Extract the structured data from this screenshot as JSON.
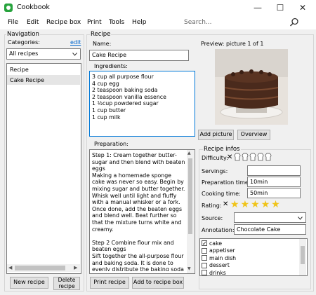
{
  "window": {
    "title": "Cookbook",
    "minimize": "—",
    "maximize": "☐",
    "close": "✕"
  },
  "menu": [
    "File",
    "Edit",
    "Recipe box",
    "Print",
    "Tools",
    "Help"
  ],
  "search": {
    "placeholder": "Search..."
  },
  "navigation": {
    "title": "Navigation",
    "categories_label": "Categories:",
    "edit_link": "edit",
    "filter_value": "All recipes",
    "list": [
      "Recipe",
      "Cake Recipe"
    ],
    "new_recipe_button": "New recipe",
    "delete_recipe_button": "Delete recipe"
  },
  "recipe": {
    "title": "Recipe",
    "name_label": "Name:",
    "name_value": "Cake Recipe",
    "ingredients_label": "Ingredients:",
    "ingredients": [
      "3 cup all purpose flour",
      "4 cup egg",
      "2 teaspoon baking soda",
      "2 teaspoon vanilla essence",
      "1 ½cup powdered sugar",
      "1 cup butter",
      "1 cup milk"
    ],
    "preparation_label": "Preparation:",
    "preparation_text": "Step 1: Cream together butter-sugar and then blend with beaten eggs\nMaking a homemade sponge cake was never so easy. Begin by mixing sugar and butter together. Whisk well until light and fluffy with a manual whisker or a fork. Once done, add the beaten eggs and blend well. Beat further so that the mixture turns white and creamy.\n\nStep 2 Combine flour mix and beaten eggs\nSift together the all-purpose flour and baking soda. It is done to evenly distribute the baking soda in flour. Gradually, add this to the egg mixture. If required, add a little milk and mix till",
    "print_button": "Print recipe",
    "add_to_box_button": "Add to recipe box"
  },
  "preview": {
    "label": "Preview: picture 1 of 1",
    "add_picture_button": "Add picture",
    "overview_button": "Overview"
  },
  "infos": {
    "title": "Recipe infos",
    "difficulty_label": "Difficulty:",
    "difficulty_level": 0,
    "difficulty_max": 5,
    "servings_label": "Servings:",
    "servings_value": "",
    "prep_time_label": "Preparation time:",
    "prep_time_value": "10min",
    "cook_time_label": "Cooking time:",
    "cook_time_value": "50min",
    "rating_label": "Rating:",
    "rating_value": 5,
    "rating_max": 5,
    "source_label": "Source:",
    "source_value": "",
    "annotation_label": "Annotation:",
    "annotation_value": "Chocolate Cake",
    "categories": [
      {
        "label": "cake",
        "checked": true
      },
      {
        "label": "appetiser",
        "checked": false
      },
      {
        "label": "main dish",
        "checked": false
      },
      {
        "label": "dessert",
        "checked": false
      },
      {
        "label": "drinks",
        "checked": false
      }
    ]
  },
  "colors": {
    "accent": "#0066cc",
    "star": "#f0c419",
    "app_icon": "#27a33d",
    "selection": "#e5e5e5"
  }
}
